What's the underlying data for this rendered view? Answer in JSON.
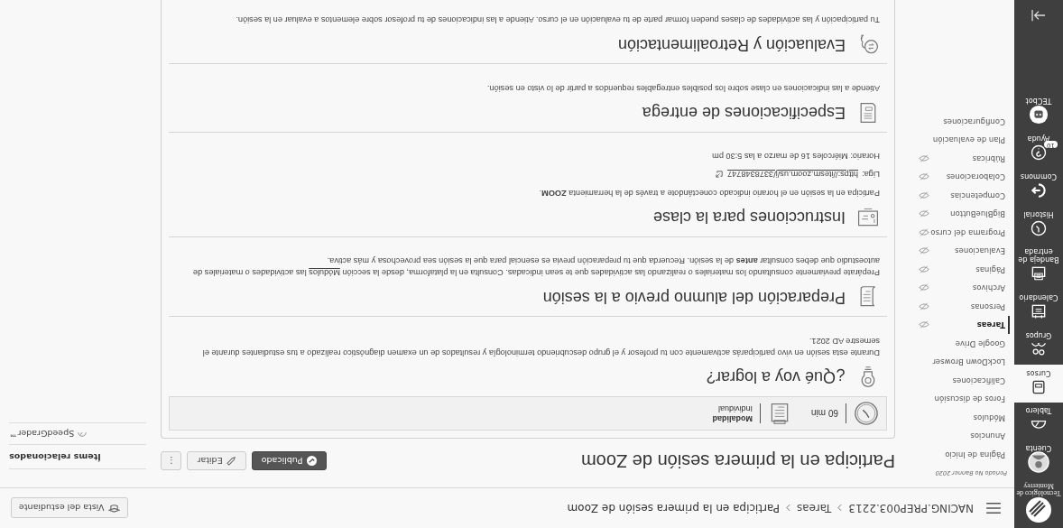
{
  "global_nav": {
    "logo_text": "Tecnológico de Monterrey",
    "items": [
      {
        "kind": "avatar",
        "label": "Cuenta",
        "selected": false
      },
      {
        "kind": "dashboard",
        "label": "Tablero",
        "selected": false
      },
      {
        "kind": "courses",
        "label": "Cursos",
        "selected": true
      },
      {
        "kind": "groups",
        "label": "Grupos",
        "selected": false
      },
      {
        "kind": "calendar",
        "label": "Calendario",
        "selected": false
      },
      {
        "kind": "inbox",
        "label": "Bandeja de entrada",
        "selected": false
      },
      {
        "kind": "history",
        "label": "Historial",
        "selected": false
      },
      {
        "kind": "commons",
        "label": "Commons",
        "selected": false
      },
      {
        "kind": "help",
        "label": "Ayuda",
        "selected": false,
        "badge": "10"
      },
      {
        "kind": "bot",
        "label": "TECbot",
        "selected": false
      }
    ]
  },
  "breadcrumbs": [
    "NACING.PREP003.2213",
    "Tareas",
    "Participa en la primera sesión de Zoom"
  ],
  "student_view_button": "Vista del estudiante",
  "course_nav": {
    "term": "Periodo No Banner 2020",
    "items": [
      {
        "label": "Página de Inicio",
        "selected": false,
        "hidden": false
      },
      {
        "label": "Anuncios",
        "selected": false,
        "hidden": false
      },
      {
        "label": "Módulos",
        "selected": false,
        "hidden": false
      },
      {
        "label": "Foros de discusión",
        "selected": false,
        "hidden": false
      },
      {
        "label": "Calificaciones",
        "selected": false,
        "hidden": false
      },
      {
        "label": "LockDown Browser",
        "selected": false,
        "hidden": false
      },
      {
        "label": "Google Drive",
        "selected": false,
        "hidden": false
      },
      {
        "label": "Tareas",
        "selected": true,
        "hidden": true
      },
      {
        "label": "Personas",
        "selected": false,
        "hidden": true
      },
      {
        "label": "Archivos",
        "selected": false,
        "hidden": true
      },
      {
        "label": "Páginas",
        "selected": false,
        "hidden": true
      },
      {
        "label": "Evaluaciones",
        "selected": false,
        "hidden": true
      },
      {
        "label": "Programa del curso",
        "selected": false,
        "hidden": true
      },
      {
        "label": "BigBlueButton",
        "selected": false,
        "hidden": true
      },
      {
        "label": "Competencias",
        "selected": false,
        "hidden": true
      },
      {
        "label": "Colaboraciones",
        "selected": false,
        "hidden": true
      },
      {
        "label": "Rúbricas",
        "selected": false,
        "hidden": true
      },
      {
        "label": "Plan de evaluación",
        "selected": false,
        "hidden": false
      },
      {
        "label": "Configuraciones",
        "selected": false,
        "hidden": false
      }
    ]
  },
  "assignment": {
    "title": "Participa en la primera sesión de Zoom",
    "published_button": "Publicado",
    "edit_button": "Editar",
    "more_button": "⋮",
    "info": {
      "duration": "60 min",
      "modality_label": "Modalidad",
      "modality_value": "Individual"
    },
    "sections": [
      {
        "kind": "goal",
        "heading": "¿Qué voy a lograr?",
        "lines": [
          {
            "kind": "text",
            "text": "Durante esta sesión en vivo participarás activamente con tu profesor y el grupo descubriendo terminología y resultados de un examen diagnóstico realizado a tus estudiantes durante el semestre AD 2021."
          }
        ]
      },
      {
        "kind": "prep",
        "heading": "Preparación del alumno previo a la sesión",
        "lines": [
          {
            "kind": "link_text",
            "before": "Prepárate previamente consultando los materiales o realizando las actividades que te sean indicadas. Consulta en la plataforma, desde la sección",
            "link": "Módulos",
            "after": "las actividades o materiales de autoestudio que debes consultar **antes** de la sesión. Recuerda que tu preparación previa es esencial para que la sesión sea provechosa y más activa."
          }
        ]
      },
      {
        "kind": "instructions",
        "heading": "Instrucciones para la clase",
        "lines": [
          {
            "kind": "text",
            "text": "Participa en la sesión en el horario indicado conectándote a través de la herramienta **ZOOM**."
          },
          {
            "kind": "url",
            "before": "Liga:",
            "link": "https://itesm.zoom.us/j/3378348747"
          },
          {
            "kind": "text",
            "text": "Horario: Miércoles 16 de marzo a las 5:30 pm"
          }
        ]
      },
      {
        "kind": "delivery",
        "heading": "Especificaciones de entrega",
        "lines": [
          {
            "kind": "text",
            "text": "Atiende a las indicaciones en clase sobre los posibles entregables requeridos a partir de lo visto en sesión."
          }
        ]
      },
      {
        "kind": "evaluation",
        "heading": "Evaluación y Retroalimentación",
        "lines": [
          {
            "kind": "text",
            "text": "Tu participación y las actividades de clases pueden formar parte de tu evaluación en el curso. Atiende a las indicaciones de tu profesor sobre elementos a evaluar en la sesión."
          }
        ]
      }
    ]
  },
  "related": {
    "heading": "Ítems relacionados",
    "items": [
      "SpeedGrader™"
    ]
  }
}
